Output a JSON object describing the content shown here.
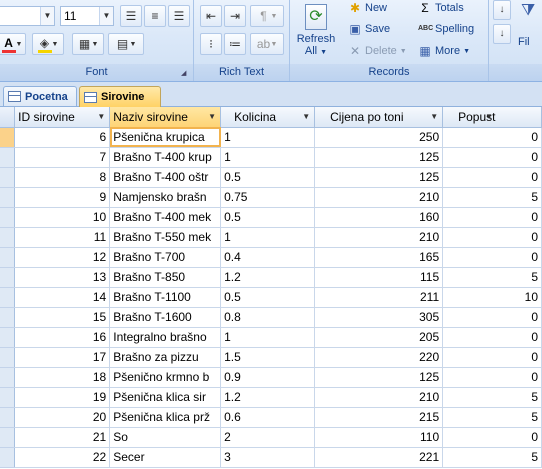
{
  "ribbon": {
    "font_size_value": "11",
    "groups": {
      "font": "Font",
      "rich_text": "Rich Text",
      "records": "Records"
    },
    "refresh": {
      "line1": "Refresh",
      "line2": "All"
    },
    "records_buttons": {
      "new": "New",
      "save": "Save",
      "delete": "Delete",
      "totals": "Totals",
      "spelling": "Spelling",
      "more": "More"
    },
    "cut_off_text": "Fil"
  },
  "tabs": [
    {
      "label": "Pocetna"
    },
    {
      "label": "Sirovine"
    }
  ],
  "datasheet": {
    "columns": [
      "ID sirovine",
      "Naziv sirovine",
      "Kolicina",
      "Cijena po toni",
      "Popust"
    ],
    "rows": [
      {
        "id": "6",
        "naziv": "Pšenična krupica",
        "kolicina": "1",
        "cijena": "250",
        "popust": "0"
      },
      {
        "id": "7",
        "naziv": "Brašno T-400 krup",
        "kolicina": "1",
        "cijena": "125",
        "popust": "0"
      },
      {
        "id": "8",
        "naziv": "Brašno T-400 oštr",
        "kolicina": "0.5",
        "cijena": "125",
        "popust": "0"
      },
      {
        "id": "9",
        "naziv": "Namjensko brašn",
        "kolicina": "0.75",
        "cijena": "210",
        "popust": "5"
      },
      {
        "id": "10",
        "naziv": "Brašno T-400 mek",
        "kolicina": "0.5",
        "cijena": "160",
        "popust": "0"
      },
      {
        "id": "11",
        "naziv": "Brašno T-550 mek",
        "kolicina": "1",
        "cijena": "210",
        "popust": "0"
      },
      {
        "id": "12",
        "naziv": "Brašno T-700",
        "kolicina": "0.4",
        "cijena": "165",
        "popust": "0"
      },
      {
        "id": "13",
        "naziv": "Brašno T-850",
        "kolicina": "1.2",
        "cijena": "115",
        "popust": "5"
      },
      {
        "id": "14",
        "naziv": "Brašno T-1100",
        "kolicina": "0.5",
        "cijena": "211",
        "popust": "10"
      },
      {
        "id": "15",
        "naziv": "Brašno T-1600",
        "kolicina": "0.8",
        "cijena": "305",
        "popust": "0"
      },
      {
        "id": "16",
        "naziv": "Integralno brašno",
        "kolicina": "1",
        "cijena": "205",
        "popust": "0"
      },
      {
        "id": "17",
        "naziv": "Brašno za pizzu",
        "kolicina": "1.5",
        "cijena": "220",
        "popust": "0"
      },
      {
        "id": "18",
        "naziv": "Pšenično krmno b",
        "kolicina": "0.9",
        "cijena": "125",
        "popust": "0"
      },
      {
        "id": "19",
        "naziv": "Pšenična klica sir",
        "kolicina": "1.2",
        "cijena": "210",
        "popust": "5"
      },
      {
        "id": "20",
        "naziv": "Pšenična klica prž",
        "kolicina": "0.6",
        "cijena": "215",
        "popust": "5"
      },
      {
        "id": "21",
        "naziv": "So",
        "kolicina": "2",
        "cijena": "110",
        "popust": "0"
      },
      {
        "id": "22",
        "naziv": "Secer",
        "kolicina": "3",
        "cijena": "221",
        "popust": "5"
      }
    ]
  },
  "colors": {
    "ribbon_bg": "#dbe8f8",
    "group_label": "#15428b",
    "active_tab": "#ffd266",
    "selected_header": "#fed476",
    "grid_line": "#c9d7ea"
  }
}
